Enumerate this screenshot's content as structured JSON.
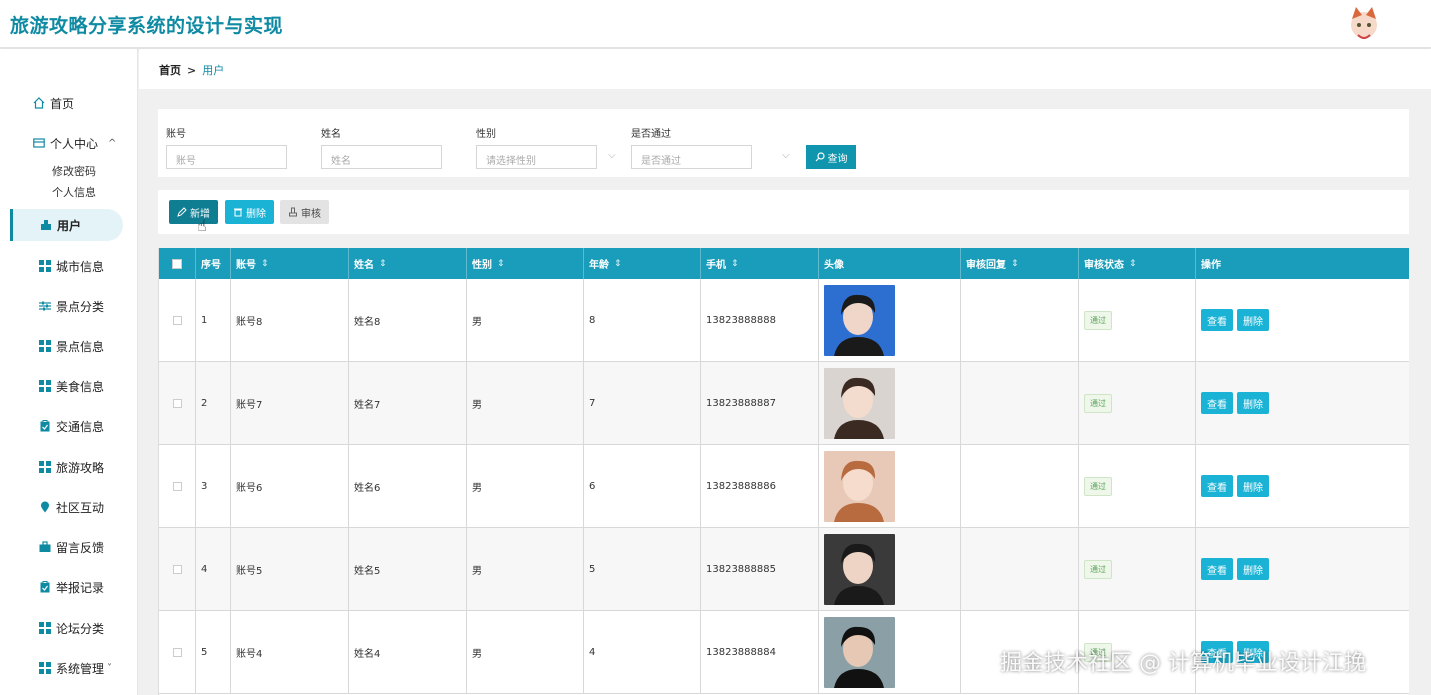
{
  "app": {
    "title": "旅游攻略分享系统的设计与实现"
  },
  "colors": {
    "accent": "#0f8aa3",
    "header_row": "#1a9dbb",
    "action_blue": "#1ab3d6"
  },
  "sidebar": {
    "home": {
      "label": "首页",
      "icon": "home-icon"
    },
    "personal": {
      "label": "个人中心",
      "icon": "id-card-icon",
      "chevron": "^",
      "children": [
        "修改密码",
        "个人信息"
      ]
    },
    "items": [
      {
        "label": "用户",
        "icon": "user-icon",
        "active": true
      },
      {
        "label": "城市信息",
        "icon": "grid-icon"
      },
      {
        "label": "景点分类",
        "icon": "sliders-icon"
      },
      {
        "label": "景点信息",
        "icon": "grid-icon"
      },
      {
        "label": "美食信息",
        "icon": "grid-icon"
      },
      {
        "label": "交通信息",
        "icon": "clipboard-icon"
      },
      {
        "label": "旅游攻略",
        "icon": "grid-icon"
      },
      {
        "label": "社区互动",
        "icon": "map-pin-icon"
      },
      {
        "label": "留言反馈",
        "icon": "briefcase-icon"
      },
      {
        "label": "举报记录",
        "icon": "clipboard-icon"
      },
      {
        "label": "论坛分类",
        "icon": "grid-icon"
      },
      {
        "label": "系统管理",
        "icon": "grid-icon",
        "chevron": "˅"
      }
    ]
  },
  "breadcrumb": {
    "home": "首页",
    "separator": ">",
    "current": "用户"
  },
  "search": {
    "account": {
      "label": "账号",
      "placeholder": "账号"
    },
    "name": {
      "label": "姓名",
      "placeholder": "姓名"
    },
    "gender": {
      "label": "性别",
      "placeholder": "请选择性别"
    },
    "approved": {
      "label": "是否通过",
      "placeholder": "是否通过"
    },
    "query_button": "查询"
  },
  "actions": {
    "add": "新增",
    "delete": "删除",
    "audit": "审核"
  },
  "table": {
    "headers": {
      "index": "序号",
      "account": "账号",
      "name": "姓名",
      "gender": "性别",
      "age": "年龄",
      "phone": "手机",
      "avatar": "头像",
      "reply": "审核回复",
      "status": "审核状态",
      "ops": "操作"
    },
    "view_label": "查看",
    "delete_label": "删除",
    "rows": [
      {
        "index": "1",
        "account": "账号8",
        "name": "姓名8",
        "gender": "男",
        "age": "8",
        "phone": "13823888888",
        "reply": "",
        "status": "通过"
      },
      {
        "index": "2",
        "account": "账号7",
        "name": "姓名7",
        "gender": "男",
        "age": "7",
        "phone": "13823888887",
        "reply": "",
        "status": "通过"
      },
      {
        "index": "3",
        "account": "账号6",
        "name": "姓名6",
        "gender": "男",
        "age": "6",
        "phone": "13823888886",
        "reply": "",
        "status": "通过"
      },
      {
        "index": "4",
        "account": "账号5",
        "name": "姓名5",
        "gender": "男",
        "age": "5",
        "phone": "13823888885",
        "reply": "",
        "status": "通过"
      },
      {
        "index": "5",
        "account": "账号4",
        "name": "姓名4",
        "gender": "男",
        "age": "4",
        "phone": "13823888884",
        "reply": "",
        "status": "通过"
      }
    ]
  },
  "watermark": "掘金技术社区 @ 计算机毕业设计江挽"
}
